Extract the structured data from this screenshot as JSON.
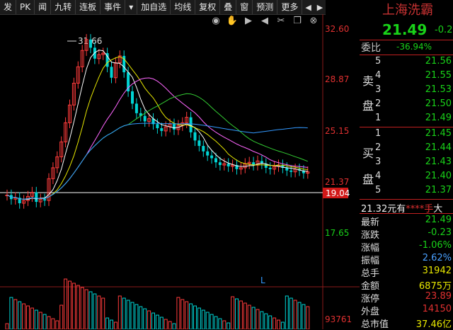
{
  "toolbar": {
    "items": [
      "发",
      "PK",
      "闻",
      "九转",
      "连板",
      "事件",
      "▾",
      "加自选",
      "均线",
      "复权",
      "叠",
      "窗",
      "预测",
      "更多",
      "◀",
      "▶"
    ]
  },
  "chart_tools": [
    "eye-icon",
    "hand-icon",
    "play-icon",
    "prev-icon",
    "scissors-icon",
    "copy-icon",
    "close-icon"
  ],
  "axis": {
    "price_ticks": [
      "32.60",
      "28.87",
      "25.15",
      "21.37",
      "17.65"
    ],
    "current_marker": "19.04",
    "high_label": "31.66",
    "volume_tick": "93761",
    "marker_L": "L"
  },
  "stock": {
    "name": "上海洗霸",
    "price": "21.49",
    "change_short": "-0.2"
  },
  "weibi": {
    "label": "委比",
    "value": "-36.94%"
  },
  "sell_side_label": [
    "卖",
    "盘"
  ],
  "buy_side_label": [
    "买",
    "盘"
  ],
  "sell_orders": [
    {
      "idx": "5",
      "price": "21.56"
    },
    {
      "idx": "4",
      "price": "21.55"
    },
    {
      "idx": "3",
      "price": "21.53"
    },
    {
      "idx": "2",
      "price": "21.50"
    },
    {
      "idx": "1",
      "price": "21.49"
    }
  ],
  "buy_orders": [
    {
      "idx": "1",
      "price": "21.45"
    },
    {
      "idx": "2",
      "price": "21.44"
    },
    {
      "idx": "3",
      "price": "21.43"
    },
    {
      "idx": "4",
      "price": "21.40"
    },
    {
      "idx": "5",
      "price": "21.37"
    }
  ],
  "extra": {
    "price": "21.32元有",
    "stars": "****手",
    "tail": "大"
  },
  "stats": [
    {
      "label": "最新",
      "value": "21.49",
      "color": "#19d219"
    },
    {
      "label": "涨跌",
      "value": "-0.23",
      "color": "#19d219"
    },
    {
      "label": "涨幅",
      "value": "-1.06%",
      "color": "#19d219"
    },
    {
      "label": "振幅",
      "value": "2.62%",
      "color": "#4aa0ff"
    },
    {
      "label": "总手",
      "value": "31942",
      "color": "#e8e800"
    },
    {
      "label": "金额",
      "value": "6875万",
      "color": "#e8e800"
    },
    {
      "label": "涨停",
      "value": "23.89",
      "color": "#e03030"
    },
    {
      "label": "外盘",
      "value": "14150",
      "color": "#e03030"
    },
    {
      "label": "总市值",
      "value": "37.46亿",
      "color": "#e8e800"
    }
  ],
  "colors": {
    "up": "#ff3b3b",
    "down": "#00d4d4",
    "ma5": "#ffffff",
    "ma10": "#e8e800",
    "ma20": "#ff66ff",
    "ma30": "#33cc33",
    "ma60": "#3399ff"
  }
}
